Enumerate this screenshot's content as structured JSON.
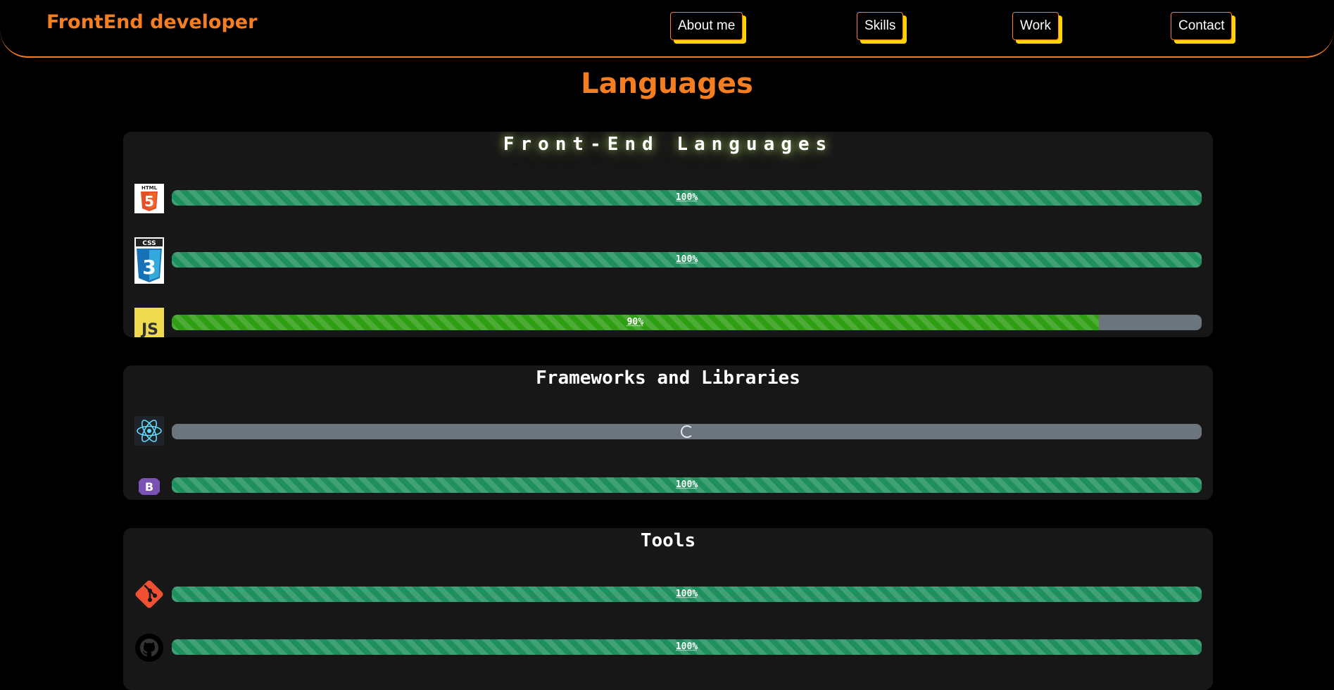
{
  "header": {
    "brand": "FrontEnd developer",
    "nav": [
      "About me",
      "Skills",
      "Work",
      "Contact"
    ]
  },
  "section_title": "Languages",
  "cards": [
    {
      "title": "Front-End Languages",
      "items": [
        {
          "icon": "html5-icon",
          "icon_text": "HTML",
          "logo_digit": "5",
          "percent": 100,
          "label": "100%"
        },
        {
          "icon": "css3-icon",
          "icon_text": "CSS",
          "logo_digit": "3",
          "percent": 100,
          "label": "100%"
        },
        {
          "icon": "javascript-icon",
          "icon_text": "JS",
          "percent": 90,
          "label": "90%"
        }
      ]
    },
    {
      "title": "Frameworks and Libraries",
      "items": [
        {
          "icon": "react-icon",
          "status": "loading"
        },
        {
          "icon": "bootstrap-icon",
          "icon_text": "B",
          "percent": 100,
          "label": "100%"
        }
      ]
    },
    {
      "title": "Tools",
      "items": [
        {
          "icon": "git-icon",
          "percent": 100,
          "label": "100%"
        },
        {
          "icon": "github-icon",
          "percent": 100,
          "label": "100%"
        }
      ]
    }
  ],
  "colors": {
    "accent": "#f57f20",
    "nav_shadow": "#ffd400",
    "bar_track": "#6c757d",
    "bar_fill": "#1f8f5e",
    "bar_fill_js": "#2e9e12",
    "card_bg": "#171717"
  }
}
